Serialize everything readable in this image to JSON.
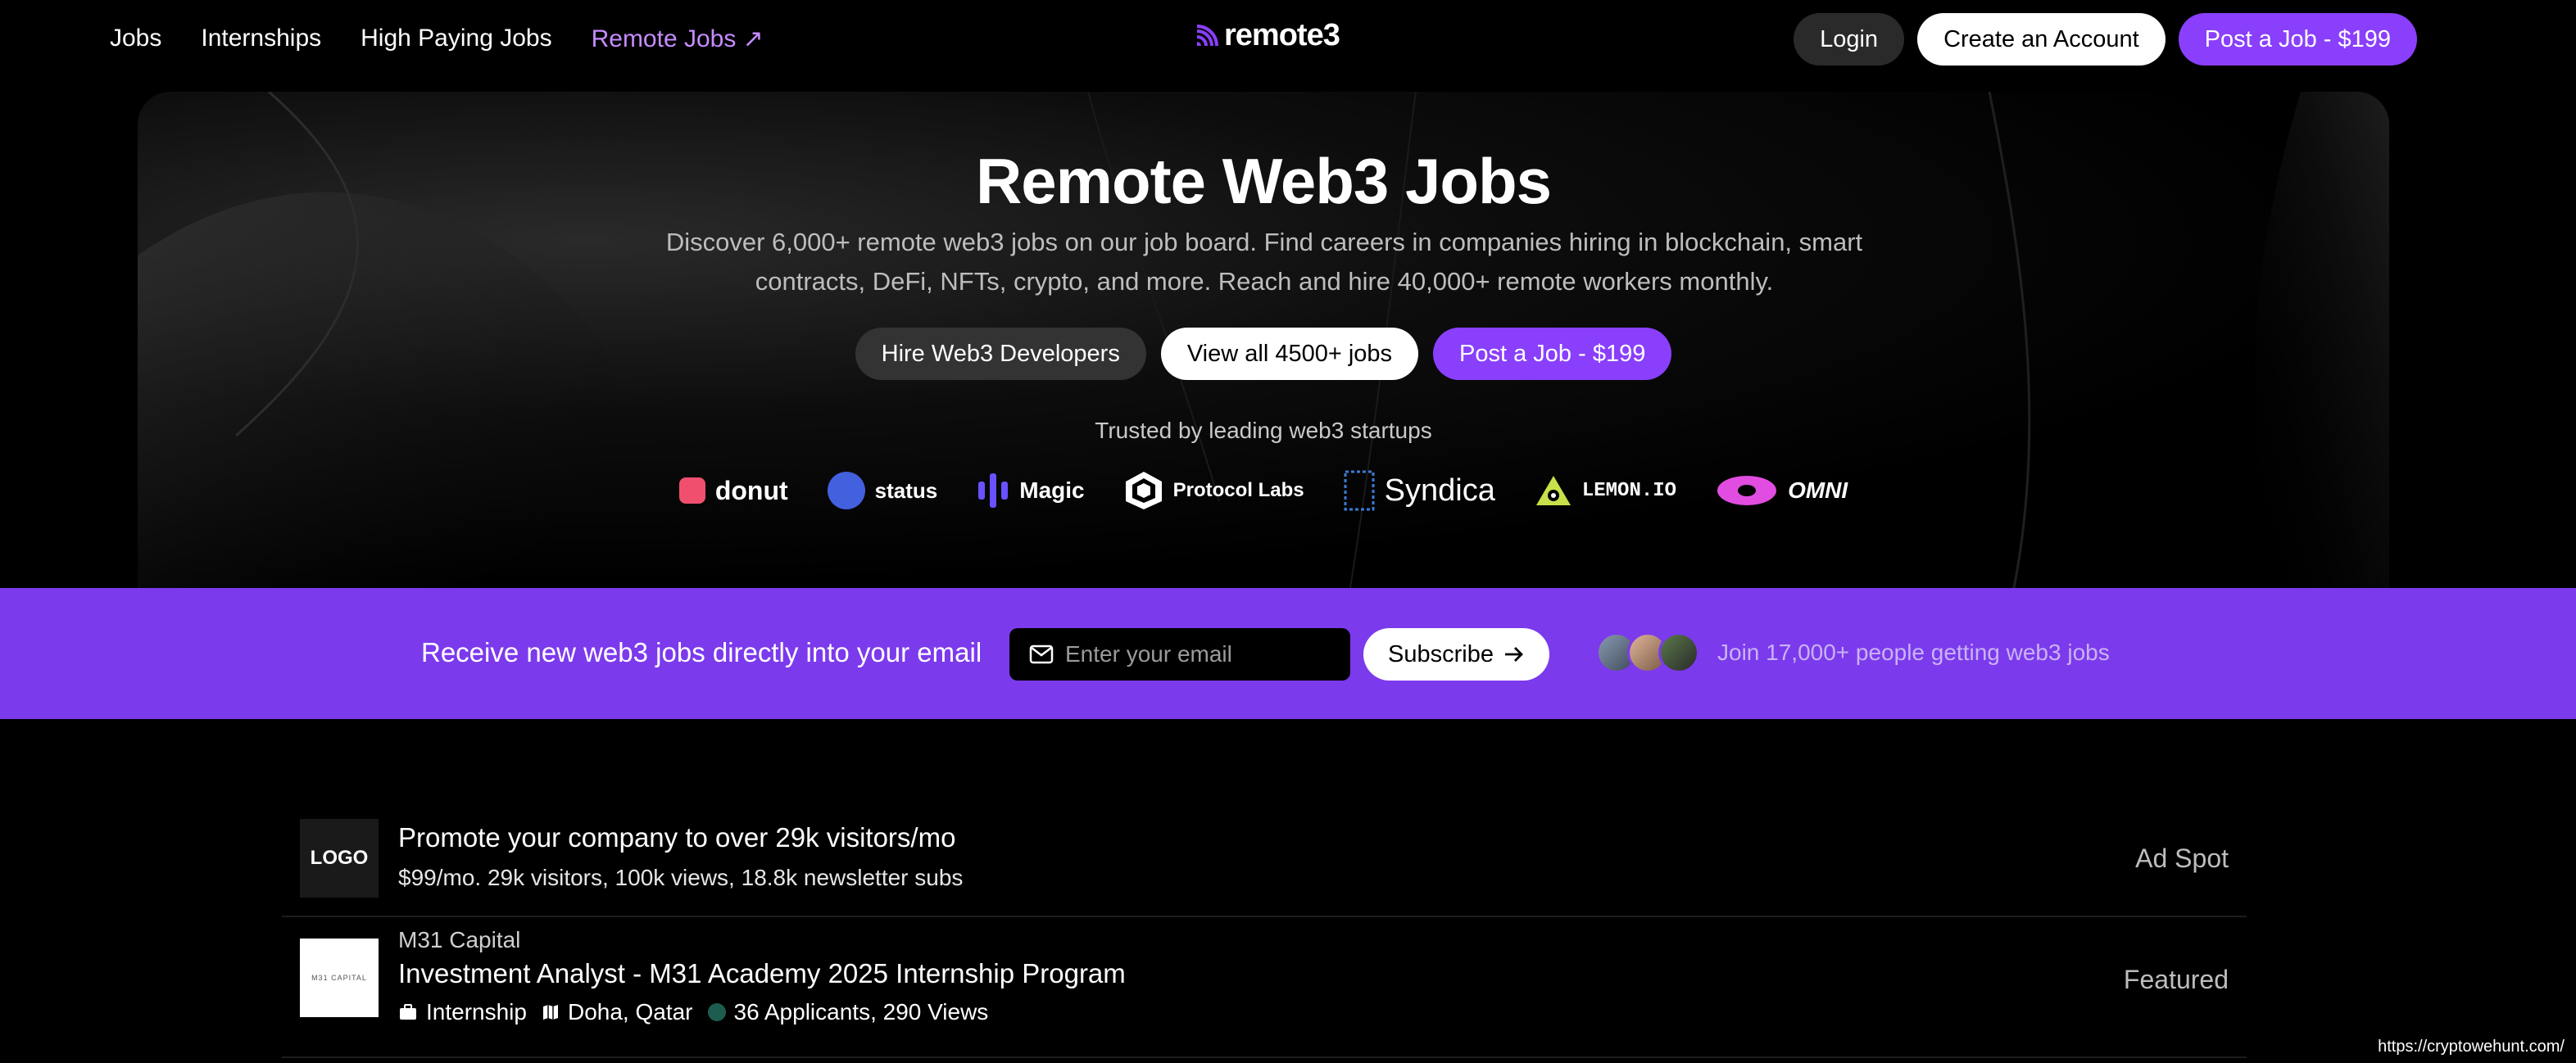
{
  "nav": {
    "links": [
      "Jobs",
      "Internships",
      "High Paying Jobs",
      "Remote Jobs ↗"
    ],
    "logo_text": "remote3",
    "login_label": "Login",
    "create_account_label": "Create an Account",
    "post_job_label": "Post a Job - $199"
  },
  "hero": {
    "title": "Remote Web3 Jobs",
    "description": "Discover 6,000+ remote web3 jobs on our job board. Find careers in companies hiring in blockchain, smart contracts, DeFi, NFTs, crypto, and more. Reach and hire 40,000+ remote workers monthly.",
    "hire_label": "Hire Web3 Developers",
    "view_all_label": "View all 4500+ jobs",
    "post_job_label": "Post a Job - $199",
    "trusted": "Trusted by leading web3 startups",
    "brands": [
      "donut",
      "status",
      "Magic",
      "Protocol Labs",
      "Syndica",
      "LEMON.IO",
      "OMNI"
    ]
  },
  "subscribe": {
    "text": "Receive new web3 jobs directly into your email",
    "email_placeholder": "Enter your email",
    "button_label": "Subscribe",
    "join_text": "Join 17,000+ people getting web3 jobs"
  },
  "jobs": {
    "ad": {
      "logo_text": "LOGO",
      "title": "Promote your company to over 29k visitors/mo",
      "subtitle": "$99/mo. 29k visitors, 100k views, 18.8k newsletter subs",
      "tag": "Ad Spot"
    },
    "featured": {
      "logo_text": "M31 CAPITAL",
      "company": "M31 Capital",
      "title": "Investment Analyst - M31 Academy 2025 Internship Program",
      "type": "Internship",
      "location": "Doha, Qatar",
      "stats": "36 Applicants, 290 Views",
      "tag": "Featured"
    }
  },
  "status_url": "https://cryptowehunt.com/",
  "colors": {
    "accent": "#8a3ffc",
    "banner": "#7c3aed",
    "nav_highlight": "#c68cff"
  }
}
